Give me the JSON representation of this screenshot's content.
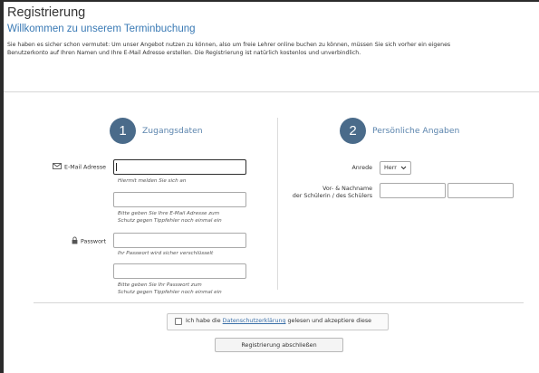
{
  "header": {
    "title": "Registrierung",
    "subtitle": "Willkommen zu unserem Terminbuchung",
    "intro_line1": "Sie haben es sicher schon vermutet: Um unser Angebot nutzen zu können, also um freie Lehrer online buchen zu können, müssen Sie sich vorher ein eigenes",
    "intro_line2": "Benutzerkonto auf Ihren Namen und Ihre E-Mail Adresse erstellen. Die Registrierung ist natürlich kostenlos und unverbindlich."
  },
  "section_access": {
    "number": "1",
    "title": "Zugangsdaten",
    "email_label": "E-Mail Adresse",
    "email_value": "",
    "email_hint": "Hiermit melden Sie sich an",
    "email_confirm_value": "",
    "email_confirm_hint_1": "Bitte geben Sie Ihre E-Mail Adresse zum",
    "email_confirm_hint_2": "Schutz gegen Tippfehler noch einmal ein",
    "password_label": "Passwort",
    "password_value": "",
    "password_hint": "Ihr Passwort wird sicher verschlüsselt",
    "password_confirm_value": "",
    "password_confirm_hint_1": "Bitte geben Sie Ihr Passwort zum",
    "password_confirm_hint_2": "Schutz gegen Tippfehler noch einmal ein",
    "email_icon": "envelope-icon",
    "password_icon": "lock-icon"
  },
  "section_personal": {
    "number": "2",
    "title": "Persönliche Angaben",
    "salutation_label": "Anrede",
    "salutation_value": "Herr",
    "name_label_line1": "Vor- & Nachname",
    "name_label_line2": "der Schülerin / des Schülers",
    "first_name_value": "",
    "last_name_value": ""
  },
  "consent": {
    "prefix": "Ich habe die ",
    "link": "Datenschutzerklärung",
    "suffix": " gelesen und akzeptiere diese",
    "checked": false
  },
  "submit": {
    "label": "Registrierung abschließen"
  },
  "colors": {
    "accent": "#5b84ad",
    "step_circle": "#4a6b8a",
    "subtitle": "#3a7ab5"
  }
}
